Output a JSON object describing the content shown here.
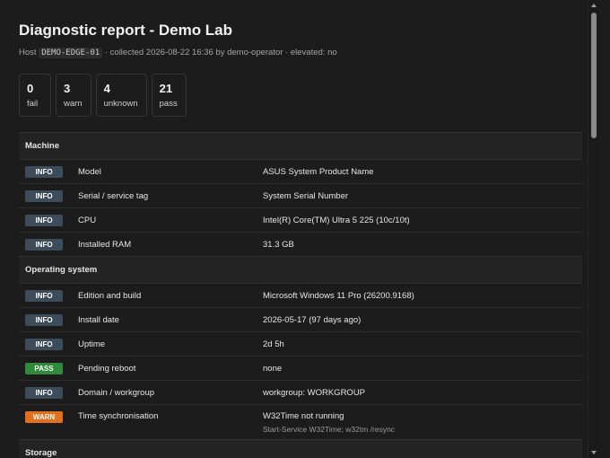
{
  "title": "Diagnostic report - Demo Lab",
  "subtitle": {
    "host_prefix": "Host",
    "host": "DEMO-EDGE-01",
    "rest": "· collected 2026-08-22 16:36 by demo-operator · elevated: no"
  },
  "summary": [
    {
      "count": "0",
      "label": "fail"
    },
    {
      "count": "3",
      "label": "warn"
    },
    {
      "count": "4",
      "label": "unknown"
    },
    {
      "count": "21",
      "label": "pass"
    }
  ],
  "status_colors": {
    "INFO": "#3d4c5a",
    "PASS": "#2f8a3a",
    "WARN": "#e0701c"
  },
  "sections": [
    {
      "title": "Machine",
      "rows": [
        {
          "status": "INFO",
          "label": "Model",
          "value": "ASUS System Product Name"
        },
        {
          "status": "INFO",
          "label": "Serial / service tag",
          "value": "System Serial Number"
        },
        {
          "status": "INFO",
          "label": "CPU",
          "value": "Intel(R) Core(TM) Ultra 5 225 (10c/10t)"
        },
        {
          "status": "INFO",
          "label": "Installed RAM",
          "value": "31.3 GB"
        }
      ]
    },
    {
      "title": "Operating system",
      "rows": [
        {
          "status": "INFO",
          "label": "Edition and build",
          "value": "Microsoft Windows 11 Pro (26200.9168)"
        },
        {
          "status": "INFO",
          "label": "Install date",
          "value": "2026-05-17 (97 days ago)"
        },
        {
          "status": "INFO",
          "label": "Uptime",
          "value": "2d 5h"
        },
        {
          "status": "PASS",
          "label": "Pending reboot",
          "value": "none"
        },
        {
          "status": "INFO",
          "label": "Domain / workgroup",
          "value": "workgroup: WORKGROUP"
        },
        {
          "status": "WARN",
          "label": "Time synchronisation",
          "value": "W32Time not running",
          "hint": "Start-Service W32Time; w32tm /resync"
        }
      ]
    },
    {
      "title": "Storage",
      "rows": []
    }
  ]
}
